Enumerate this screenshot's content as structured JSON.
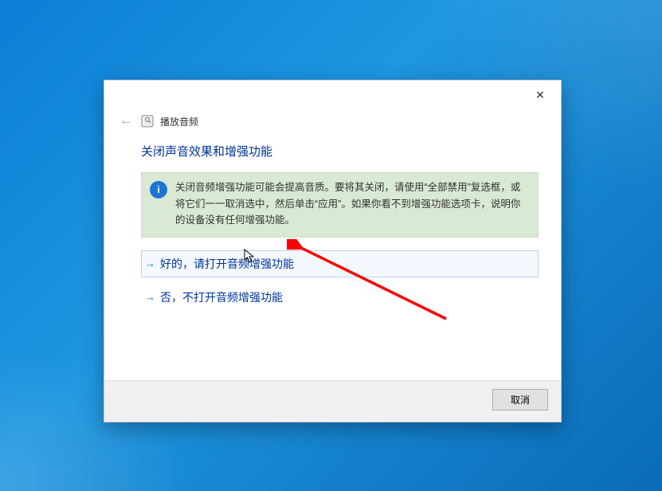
{
  "window": {
    "title": "播放音频",
    "close_label": "✕"
  },
  "page": {
    "heading": "关闭声音效果和增强功能",
    "info_text": "关闭音频增强功能可能会提高音质。要将其关闭，请使用“全部禁用”复选框，或将它们一一取消选中，然后单击“应用”。如果你看不到增强功能选项卡，说明你的设备没有任何增强功能。"
  },
  "options": {
    "yes": "好的，请打开音频增强功能",
    "no": "否，不打开音频增强功能"
  },
  "footer": {
    "cancel": "取消"
  }
}
